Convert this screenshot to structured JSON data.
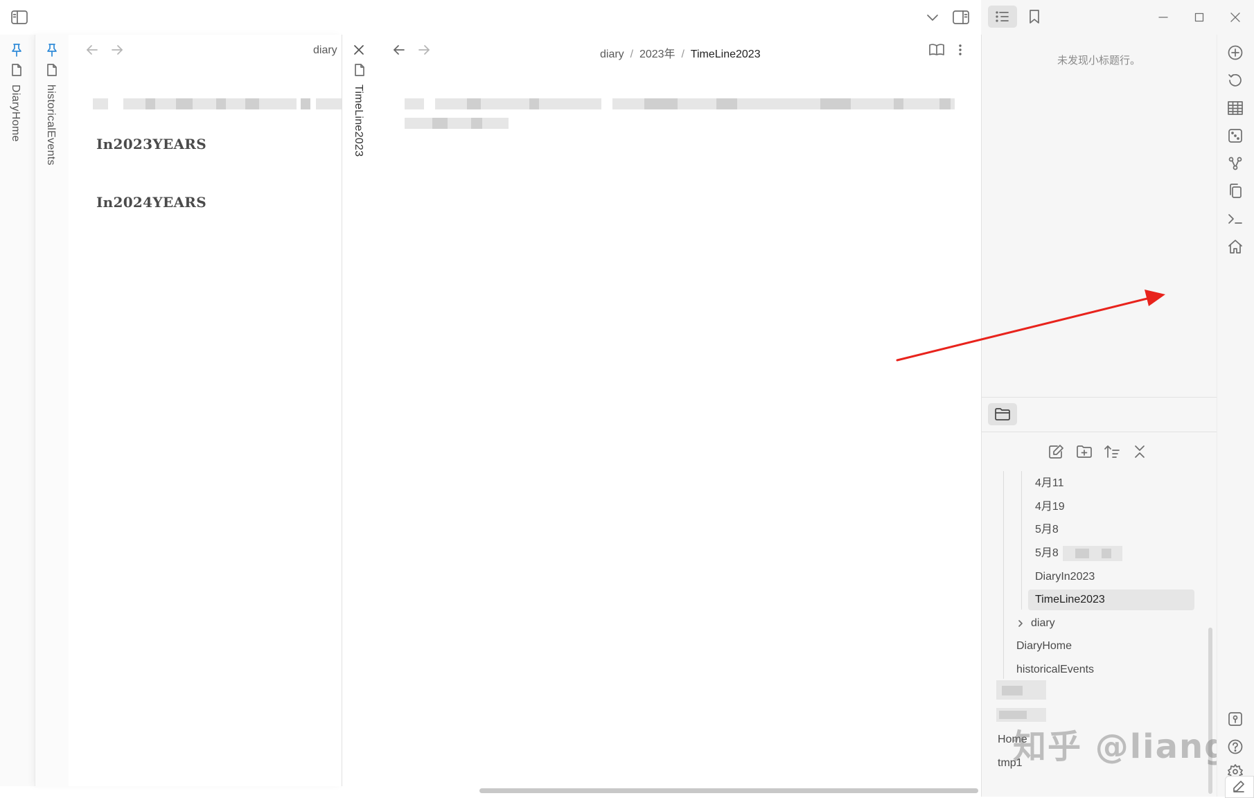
{
  "panes": {
    "diary_home": {
      "tab_label": "DiaryHome"
    },
    "historical_events": {
      "tab_label": "historicalEvents",
      "header_title": "diary",
      "headings": [
        "In2023YEARS",
        "In2024YEARS"
      ]
    },
    "timeline": {
      "tab_label": "TimeLine2023",
      "breadcrumb": [
        "diary",
        "2023年",
        "TimeLine2023"
      ]
    }
  },
  "outline": {
    "empty_text": "未发现小标题行。"
  },
  "file_tree": {
    "items": [
      {
        "label": "4月11",
        "active": false
      },
      {
        "label": "4月19",
        "active": false
      },
      {
        "label": "5月8",
        "active": false
      },
      {
        "label": "5月8",
        "active": false
      },
      {
        "label": "DiaryIn2023",
        "active": false
      },
      {
        "label": "TimeLine2023",
        "active": true
      }
    ],
    "folder": "diary",
    "root_items": [
      "DiaryHome",
      "historicalEvents"
    ],
    "bottom_items": [
      "Home",
      "tmp1"
    ]
  },
  "watermark": "知乎 @liang",
  "colors": {
    "accent": "#2e8ad8",
    "arrow": "#e8231c",
    "active_row": "#e6e6e6"
  },
  "icons": {
    "sidebar_toggle": "sidebar-left-icon",
    "outline": "list-icon",
    "bookmark": "bookmark-icon",
    "files": "folder-icon",
    "reading_mode": "book-open-icon"
  }
}
